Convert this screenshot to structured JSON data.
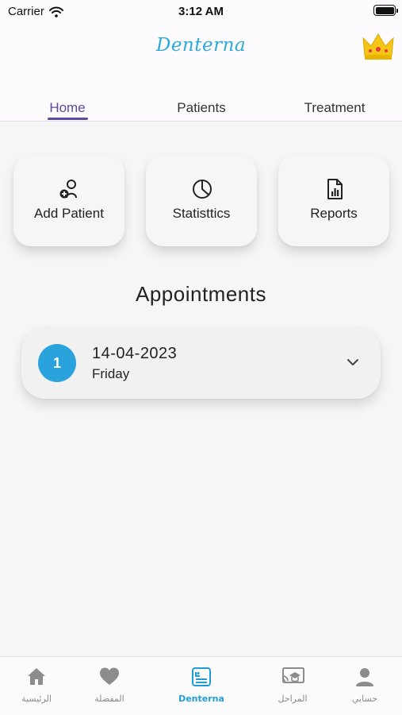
{
  "status_bar": {
    "carrier": "Carrier",
    "time": "3:12 AM"
  },
  "header": {
    "logo_text": "Denterna",
    "premium_icon": "crown-icon"
  },
  "tabs": [
    {
      "label": "Home",
      "active": true
    },
    {
      "label": "Patients",
      "active": false
    },
    {
      "label": "Treatment",
      "active": false
    }
  ],
  "quick_actions": [
    {
      "label": "Add Patient",
      "icon": "add-user-icon"
    },
    {
      "label": "Statisttics",
      "icon": "pie-chart-icon"
    },
    {
      "label": "Reports",
      "icon": "report-file-icon"
    }
  ],
  "appointments": {
    "title": "Appointments",
    "items": [
      {
        "count": "1",
        "date": "14-04-2023",
        "day": "Friday"
      }
    ]
  },
  "bottom_nav": [
    {
      "label": "الرئيسية",
      "icon": "home-icon",
      "active": false
    },
    {
      "label": "المفضلة",
      "icon": "heart-icon",
      "active": false
    },
    {
      "label": "Denterna",
      "icon": "denterna-card-icon",
      "active": true
    },
    {
      "label": "المراحل",
      "icon": "stages-icon",
      "active": false
    },
    {
      "label": "حسابي",
      "icon": "profile-icon",
      "active": false
    }
  ],
  "colors": {
    "accent": "#5a4aa0",
    "brand": "#2aaad8",
    "badge": "#2aa3dc",
    "nav_active": "#1f9ed6"
  }
}
